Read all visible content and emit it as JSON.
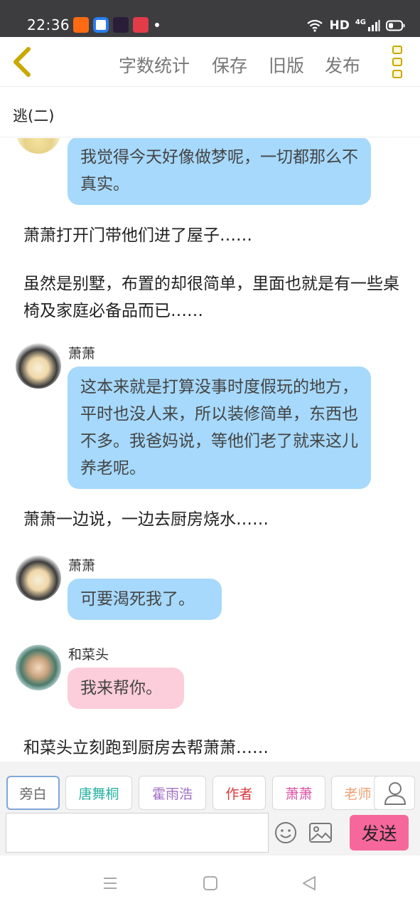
{
  "status_bar": {
    "time": "22:36",
    "network": "HD",
    "network_type": "4G",
    "app_icons": [
      "taobao-icon",
      "browser-icon",
      "video-icon",
      "heart-app-icon"
    ],
    "icons": [
      "wifi-icon",
      "signal-icon",
      "battery-icon"
    ]
  },
  "top_nav": {
    "back_icon": "chevron-left-icon",
    "items": [
      "字数统计",
      "保存",
      "旧版",
      "发布"
    ],
    "more_icon": "more-vertical-icon"
  },
  "title": "逃(二)",
  "content": {
    "first_bubble": "我觉得今天好像做梦呢，一切都那么不真实。",
    "narration_1": "萧萧打开门带他们进了屋子……",
    "narration_2": "虽然是别墅，布置的却很简单，里面也就是有一些桌椅及家庭必备品而已……",
    "msg_1": {
      "speaker": "萧萧",
      "text": "这本来就是打算没事时度假玩的地方，平时也没人来，所以装修简单，东西也不多。我爸妈说，等他们老了就来这儿养老呢。"
    },
    "narration_3": "萧萧一边说，一边去厨房烧水……",
    "msg_2": {
      "speaker": "萧萧",
      "text": "可要渴死我了。"
    },
    "msg_3": {
      "speaker": "和菜头",
      "text": "我来帮你。"
    },
    "narration_4": "和菜头立刻跑到厨房去帮萧萧……"
  },
  "roles": [
    {
      "label": "旁白",
      "color": "#666666"
    },
    {
      "label": "唐舞桐",
      "color": "#2bb3a3"
    },
    {
      "label": "霍雨浩",
      "color": "#a16fc4"
    },
    {
      "label": "作者",
      "color": "#d9383a"
    },
    {
      "label": "萧萧",
      "color": "#d94fa0"
    },
    {
      "label": "老师",
      "color": "#f0a070"
    }
  ],
  "input": {
    "placeholder": "",
    "emoji_icon": "emoji-icon",
    "image_icon": "image-icon",
    "person_icon": "person-icon"
  },
  "send_label": "发送",
  "colors": {
    "bubble_blue": "#a6d9fb",
    "bubble_pink": "#fccddb",
    "send": "#f6689b"
  }
}
